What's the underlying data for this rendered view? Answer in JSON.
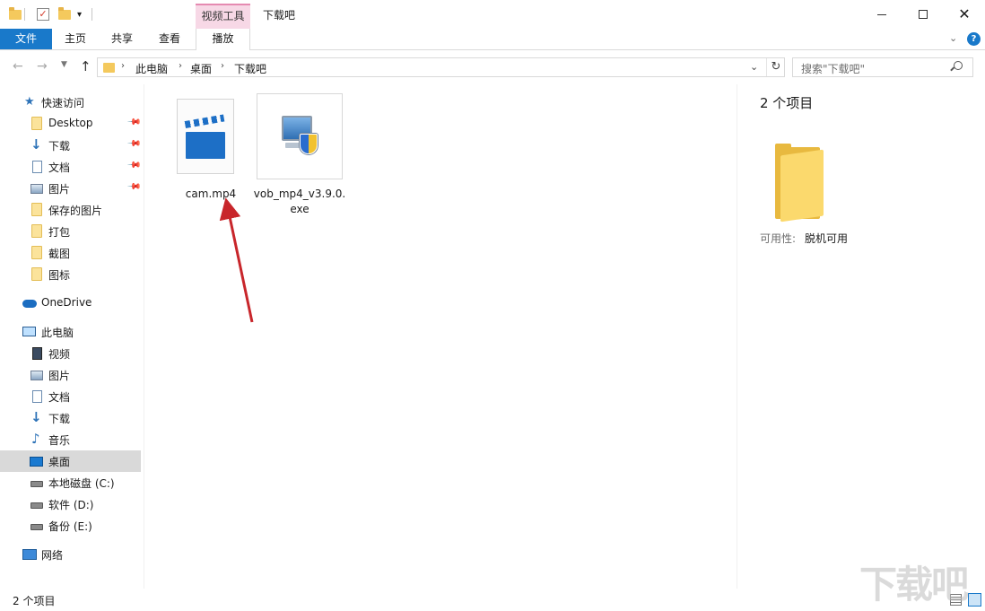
{
  "window": {
    "title": "下载吧",
    "context_group": "视频工具"
  },
  "ribbon": {
    "tabs": [
      {
        "label": "文件"
      },
      {
        "label": "主页"
      },
      {
        "label": "共享"
      },
      {
        "label": "查看"
      },
      {
        "label": "播放"
      }
    ]
  },
  "address": {
    "crumbs": [
      "此电脑",
      "桌面",
      "下载吧"
    ]
  },
  "search": {
    "placeholder": "搜索\"下载吧\""
  },
  "sidebar": {
    "items": [
      {
        "label": "快速访问",
        "icon": "star-icon"
      },
      {
        "label": "Desktop",
        "icon": "folder-icon",
        "pinned": true
      },
      {
        "label": "下载",
        "icon": "download-icon",
        "pinned": true
      },
      {
        "label": "文档",
        "icon": "document-icon",
        "pinned": true
      },
      {
        "label": "图片",
        "icon": "picture-icon",
        "pinned": true
      },
      {
        "label": "保存的图片",
        "icon": "folder-icon"
      },
      {
        "label": "打包",
        "icon": "folder-icon"
      },
      {
        "label": "截图",
        "icon": "folder-icon"
      },
      {
        "label": "图标",
        "icon": "folder-icon"
      },
      {
        "label": "OneDrive",
        "icon": "cloud-icon"
      },
      {
        "label": "此电脑",
        "icon": "computer-icon"
      },
      {
        "label": "视频",
        "icon": "video-icon"
      },
      {
        "label": "图片",
        "icon": "picture-icon"
      },
      {
        "label": "文档",
        "icon": "document-icon"
      },
      {
        "label": "下载",
        "icon": "download-icon"
      },
      {
        "label": "音乐",
        "icon": "music-icon"
      },
      {
        "label": "桌面",
        "icon": "desktop-icon",
        "selected": true
      },
      {
        "label": "本地磁盘 (C:)",
        "icon": "drive-icon"
      },
      {
        "label": "软件 (D:)",
        "icon": "drive-icon"
      },
      {
        "label": "备份 (E:)",
        "icon": "drive-icon"
      },
      {
        "label": "网络",
        "icon": "network-icon"
      }
    ]
  },
  "files": [
    {
      "name": "cam.mp4",
      "icon": "video-file-icon"
    },
    {
      "name": "vob_mp4_v3.9.0.exe",
      "icon": "installer-icon"
    }
  ],
  "details": {
    "count": "2 个项目",
    "availability_label": "可用性:",
    "availability_value": "脱机可用"
  },
  "status": {
    "count": "2 个项目"
  },
  "watermark": {
    "text": "下载吧"
  },
  "colors": {
    "accent": "#1979ca",
    "context_tab": "#f7d8e6",
    "arrow": "#c8262b"
  }
}
